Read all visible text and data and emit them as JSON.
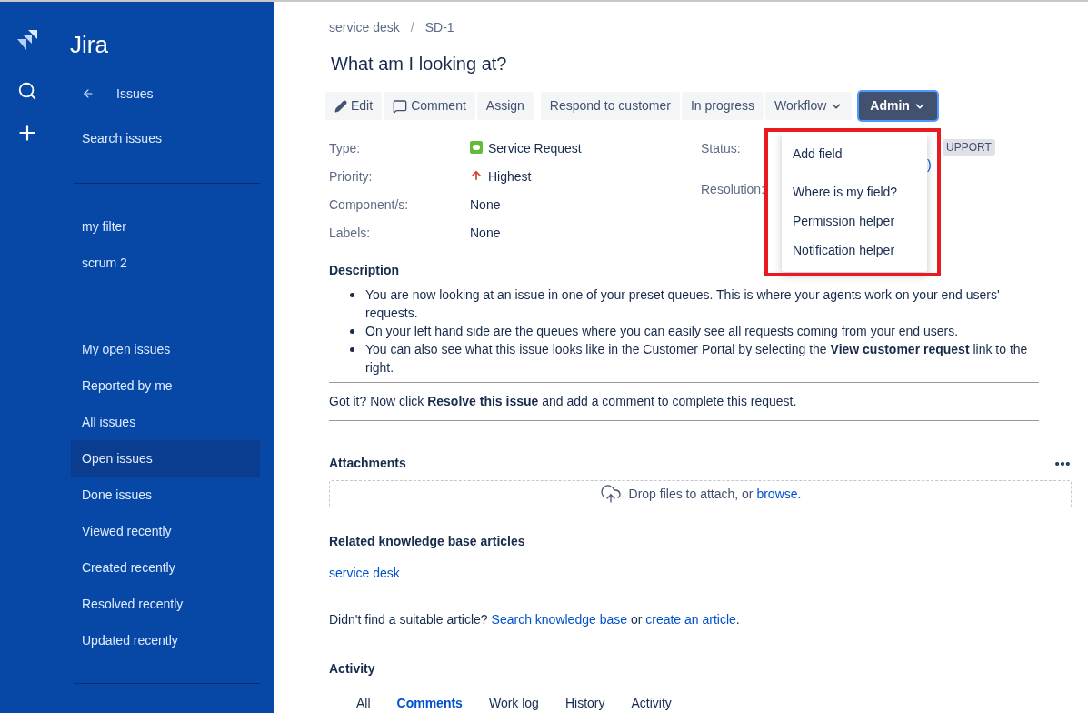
{
  "app": {
    "name": "Jira"
  },
  "sidebar": {
    "back_label": "Issues",
    "search_label": "Search issues",
    "filters": [
      {
        "label": "my filter",
        "selected": false
      },
      {
        "label": "scrum 2",
        "selected": false
      }
    ],
    "items": [
      {
        "label": "My open issues",
        "selected": false
      },
      {
        "label": "Reported by me",
        "selected": false
      },
      {
        "label": "All issues",
        "selected": false
      },
      {
        "label": "Open issues",
        "selected": true
      },
      {
        "label": "Done issues",
        "selected": false
      },
      {
        "label": "Viewed recently",
        "selected": false
      },
      {
        "label": "Created recently",
        "selected": false
      },
      {
        "label": "Resolved recently",
        "selected": false
      },
      {
        "label": "Updated recently",
        "selected": false
      }
    ]
  },
  "breadcrumbs": [
    {
      "text": "service desk",
      "kind": "link"
    },
    {
      "text": "/",
      "kind": "separator"
    },
    {
      "text": "SD-1",
      "kind": "link"
    }
  ],
  "title": "What am I looking at?",
  "toolbar": [
    [
      {
        "label": "Edit",
        "kind": "edit"
      },
      {
        "label": "Comment",
        "kind": "comment"
      },
      {
        "label": "Assign",
        "kind": "plain"
      }
    ],
    [
      {
        "label": "Respond to customer",
        "kind": "plain"
      },
      {
        "label": "In progress",
        "kind": "plain"
      },
      {
        "label": "Workflow",
        "kind": "dropdown"
      }
    ],
    [
      {
        "label": "Admin",
        "kind": "primary"
      }
    ]
  ],
  "admin_menu": {
    "open": true,
    "highlighted": true,
    "items": [
      "Add field",
      "Where is my field?",
      "Permission helper",
      "Notification helper"
    ]
  },
  "details": [
    {
      "label": "Type:",
      "value": "Service Request",
      "kind": "type"
    },
    {
      "label": "Priority:",
      "value": "Highest",
      "kind": "priority"
    },
    {
      "label": "Component/s:",
      "value": "None",
      "kind": "plain"
    },
    {
      "label": "Labels:",
      "value": "None",
      "kind": "plain"
    }
  ],
  "people": [
    {
      "label": "Status:",
      "value": "UPPORT",
      "extra": ")"
    },
    {
      "label": "Resolution:"
    }
  ],
  "description": {
    "heading": "Description",
    "bullets": [
      "You are now looking at an issue in one of your preset queues. This is where your agents work on your end users' requests.",
      "On your left hand side are the queues where you can easily see all requests coming from your end users.",
      "You can also see what this issue looks like in the Customer Portal by selecting the **View customer request** link to the right."
    ],
    "note": "Got it? Now click **Resolve this issue** and add a comment to complete this request."
  },
  "attachments": {
    "heading": "Attachments",
    "drop": [
      {
        "text": "Drop files to attach, or ",
        "kind": "text"
      },
      {
        "text": "browse.",
        "kind": "link"
      }
    ]
  },
  "knowledge": {
    "heading": "Related knowledge base articles",
    "articles": [
      "service desk"
    ],
    "footer": [
      {
        "text": "Didn't find a suitable article? ",
        "kind": "text"
      },
      {
        "text": "Search knowledge base",
        "kind": "link"
      },
      {
        "text": " or ",
        "kind": "text"
      },
      {
        "text": "create an article",
        "kind": "link"
      },
      {
        "text": ".",
        "kind": "text"
      }
    ]
  },
  "activity": {
    "heading": "Activity",
    "tabs": [
      {
        "label": "All",
        "selected": false
      },
      {
        "label": "Comments",
        "selected": true
      },
      {
        "label": "Work log",
        "selected": false
      },
      {
        "label": "History",
        "selected": false
      },
      {
        "label": "Activity",
        "selected": false
      }
    ]
  }
}
